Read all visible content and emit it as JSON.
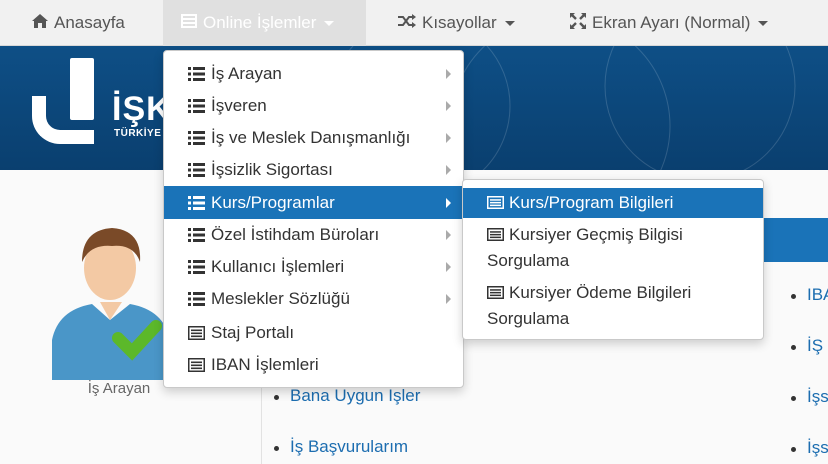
{
  "nav": {
    "home": {
      "label": "Anasayfa",
      "icon": "home-icon"
    },
    "online": {
      "label": "Online İşlemler",
      "icon": "list-icon"
    },
    "shortcuts": {
      "label": "Kısayollar",
      "icon": "shuffle-icon"
    },
    "screen": {
      "label": "Ekran Ayarı (Normal)",
      "icon": "expand-icon"
    }
  },
  "banner": {
    "logo_text": "İŞK",
    "logo_sub": "TÜRKİYE"
  },
  "menu": {
    "items": [
      {
        "label": "İş Arayan"
      },
      {
        "label": "İşveren"
      },
      {
        "label": "İş ve Meslek Danışmanlığı"
      },
      {
        "label": "İşsizlik Sigortası"
      },
      {
        "label": "Kurs/Programlar"
      },
      {
        "label": "Özel İstihdam Büroları"
      },
      {
        "label": "Kullanıcı İşlemleri"
      },
      {
        "label": "Meslekler Sözlüğü"
      },
      {
        "label": "Staj Portalı"
      },
      {
        "label": "IBAN İşlemleri"
      }
    ]
  },
  "submenu": {
    "items": [
      {
        "label": "Kurs/Program Bilgileri"
      },
      {
        "label": "Kursiyer Geçmiş Bilgisi Sorgulama"
      },
      {
        "label": "Kursiyer Ödeme Bilgileri Sorgulama"
      }
    ]
  },
  "page": {
    "avatar_label": "İş Arayan",
    "links": {
      "uygun": "Bana Uygun İşler",
      "basvuru": "İş Başvurularım",
      "right1": "IBA",
      "right2": "İŞ",
      "right3": "İşs",
      "right4": "İşs"
    }
  },
  "colors": {
    "accent": "#1a73b8",
    "banner": "#0e4f86",
    "link": "#1c6db0"
  }
}
